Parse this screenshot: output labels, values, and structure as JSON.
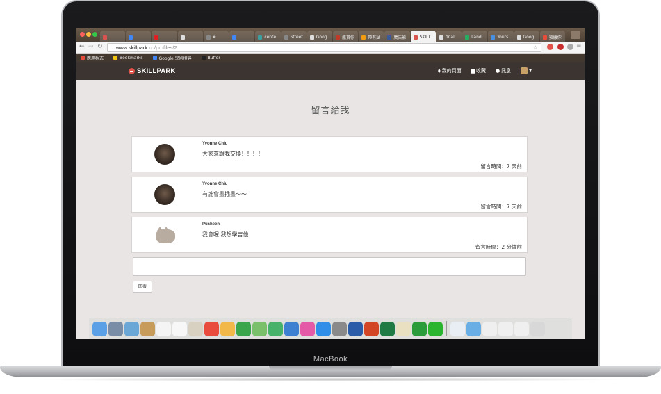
{
  "device": {
    "brand_label": "MacBook"
  },
  "browser": {
    "tabs": [
      {
        "label": "",
        "color": "#d9534f"
      },
      {
        "label": "",
        "color": "#4285f4"
      },
      {
        "label": "",
        "color": "#e02020"
      },
      {
        "label": "",
        "color": "#dddddd"
      },
      {
        "label": "#",
        "color": "#888888"
      },
      {
        "label": "",
        "color": "#4285f4"
      },
      {
        "label": "cente",
        "color": "#3aa0a0"
      },
      {
        "label": "Street",
        "color": "#888888"
      },
      {
        "label": "Goog",
        "color": "#dddddd"
      },
      {
        "label": "瓶貫你",
        "color": "#c0392b"
      },
      {
        "label": "帶有試",
        "color": "#f39c12"
      },
      {
        "label": "廣告影",
        "color": "#3b5998"
      },
      {
        "label": "SKILL",
        "color": "#d9534f",
        "active": true
      },
      {
        "label": "final",
        "color": "#dddddd"
      },
      {
        "label": "Landi",
        "color": "#27ae60"
      },
      {
        "label": "Yours",
        "color": "#4a90e2"
      },
      {
        "label": "Goog",
        "color": "#dddddd"
      },
      {
        "label": "預繳你",
        "color": "#e74c3c"
      }
    ],
    "url_host": "www.skillpark.co",
    "url_path": "/profiles/2",
    "bookmarks": [
      {
        "label": "應用程式",
        "color": "#e74c3c"
      },
      {
        "label": "Bookmarks",
        "color": "#f1c40f"
      },
      {
        "label": "Google 學術搜尋",
        "color": "#4285f4"
      },
      {
        "label": "Buffer",
        "color": "#222222"
      }
    ]
  },
  "site": {
    "logo": "SKILLPARK",
    "nav": {
      "my_page": "我的頁面",
      "favorites": "收藏",
      "messages": "訊息"
    }
  },
  "page": {
    "title": "留言給我",
    "comments": [
      {
        "name": "Yvonne Chiu",
        "body": "大家來跟我交換！！！！",
        "time": "留言時間：7 天前",
        "avatar": "photo"
      },
      {
        "name": "Yvonne Chiu",
        "body": "有誰會畫插畫～～",
        "time": "留言時間：7 天前",
        "avatar": "photo"
      },
      {
        "name": "Pusheen",
        "body": "我會喔 我想學吉他！",
        "time": "留言時間：2 分鐘前",
        "avatar": "cat"
      }
    ],
    "reply_placeholder": "",
    "reply_button": "回覆"
  },
  "dock": {
    "icons": [
      {
        "name": "finder-icon",
        "color": "#5aa0e6"
      },
      {
        "name": "launchpad-icon",
        "color": "#7a8da6"
      },
      {
        "name": "preview-icon",
        "color": "#6aa6d6"
      },
      {
        "name": "notes-icon",
        "color": "#c79b5a"
      },
      {
        "name": "calendar-icon",
        "color": "#f4f4f4"
      },
      {
        "name": "reminders-icon",
        "color": "#f7f7f7"
      },
      {
        "name": "photos-app-icon",
        "color": "#d8d0c0"
      },
      {
        "name": "chrome-icon",
        "color": "#e94b3c"
      },
      {
        "name": "photos-icon",
        "color": "#f2b84a"
      },
      {
        "name": "facetime-icon",
        "color": "#3aa54a"
      },
      {
        "name": "maps-icon",
        "color": "#7ac06a"
      },
      {
        "name": "numbers-icon",
        "color": "#47b36a"
      },
      {
        "name": "keynote-icon",
        "color": "#3d7fd0"
      },
      {
        "name": "itunes-icon",
        "color": "#e45aa6"
      },
      {
        "name": "appstore-icon",
        "color": "#2f8fe8"
      },
      {
        "name": "system-preferences-icon",
        "color": "#8a8a8a"
      },
      {
        "name": "word-icon",
        "color": "#2b5ca8"
      },
      {
        "name": "powerpoint-icon",
        "color": "#d24625"
      },
      {
        "name": "excel-icon",
        "color": "#1f7a44"
      },
      {
        "name": "keyboard-icon",
        "color": "#e8e0c0"
      },
      {
        "name": "evernote-icon",
        "color": "#2a9d3a"
      },
      {
        "name": "line-icon",
        "color": "#2bb52e"
      },
      {
        "name": "document-icon",
        "color": "#e9eef5"
      },
      {
        "name": "folder-icon",
        "color": "#6aaee6"
      },
      {
        "name": "screenshot-icon",
        "color": "#efefef"
      },
      {
        "name": "mail-icon",
        "color": "#efefef"
      },
      {
        "name": "downloads-icon",
        "color": "#efefef"
      },
      {
        "name": "trash-icon",
        "color": "#d8d8d8"
      }
    ]
  }
}
